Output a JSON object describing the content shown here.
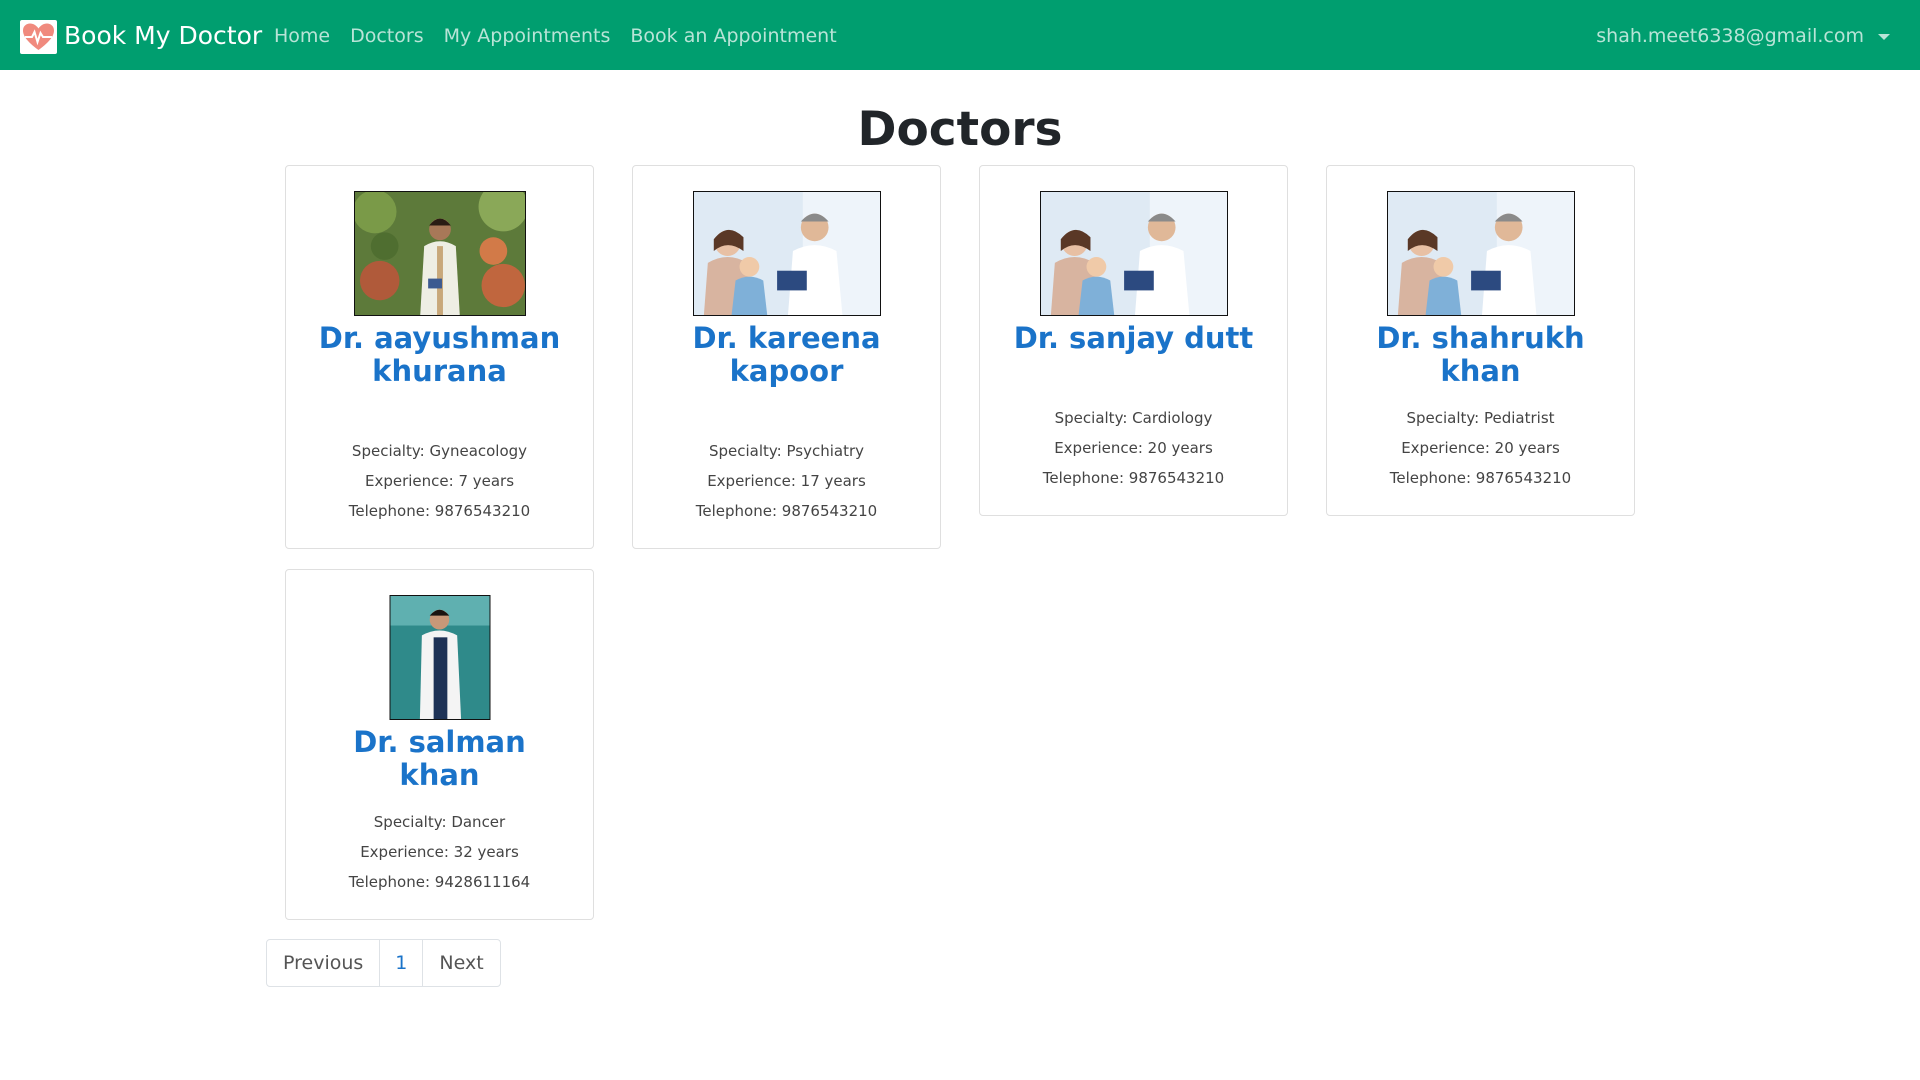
{
  "brand": {
    "name": "Book My Doctor",
    "logo_icon": "heart-pulse-icon"
  },
  "nav": {
    "links": [
      "Home",
      "Doctors",
      "My Appointments",
      "Book an Appointment"
    ],
    "user_email": "shah.meet6338@gmail.com"
  },
  "page": {
    "title": "Doctors"
  },
  "doctors": [
    {
      "name": "Dr. aayushman khurana",
      "specialty": "Specialty: Gyneacology",
      "experience": "Experience: 7 years",
      "telephone": "Telephone: 9876543210"
    },
    {
      "name": "Dr. kareena kapoor",
      "specialty": "Specialty: Psychiatry",
      "experience": "Experience: 17 years",
      "telephone": "Telephone: 9876543210"
    },
    {
      "name": "Dr. sanjay dutt",
      "specialty": "Specialty: Cardiology",
      "experience": "Experience: 20 years",
      "telephone": "Telephone: 9876543210"
    },
    {
      "name": "Dr. shahrukh khan",
      "specialty": "Specialty: Pediatrist",
      "experience": "Experience: 20 years",
      "telephone": "Telephone: 9876543210"
    },
    {
      "name": "Dr. salman khan",
      "specialty": "Specialty: Dancer",
      "experience": "Experience: 32 years",
      "telephone": "Telephone: 9428611164"
    }
  ],
  "pagination": {
    "previous": "Previous",
    "current": "1",
    "next": "Next"
  },
  "colors": {
    "navbar": "#009e6f",
    "link": "#1a73c9"
  }
}
